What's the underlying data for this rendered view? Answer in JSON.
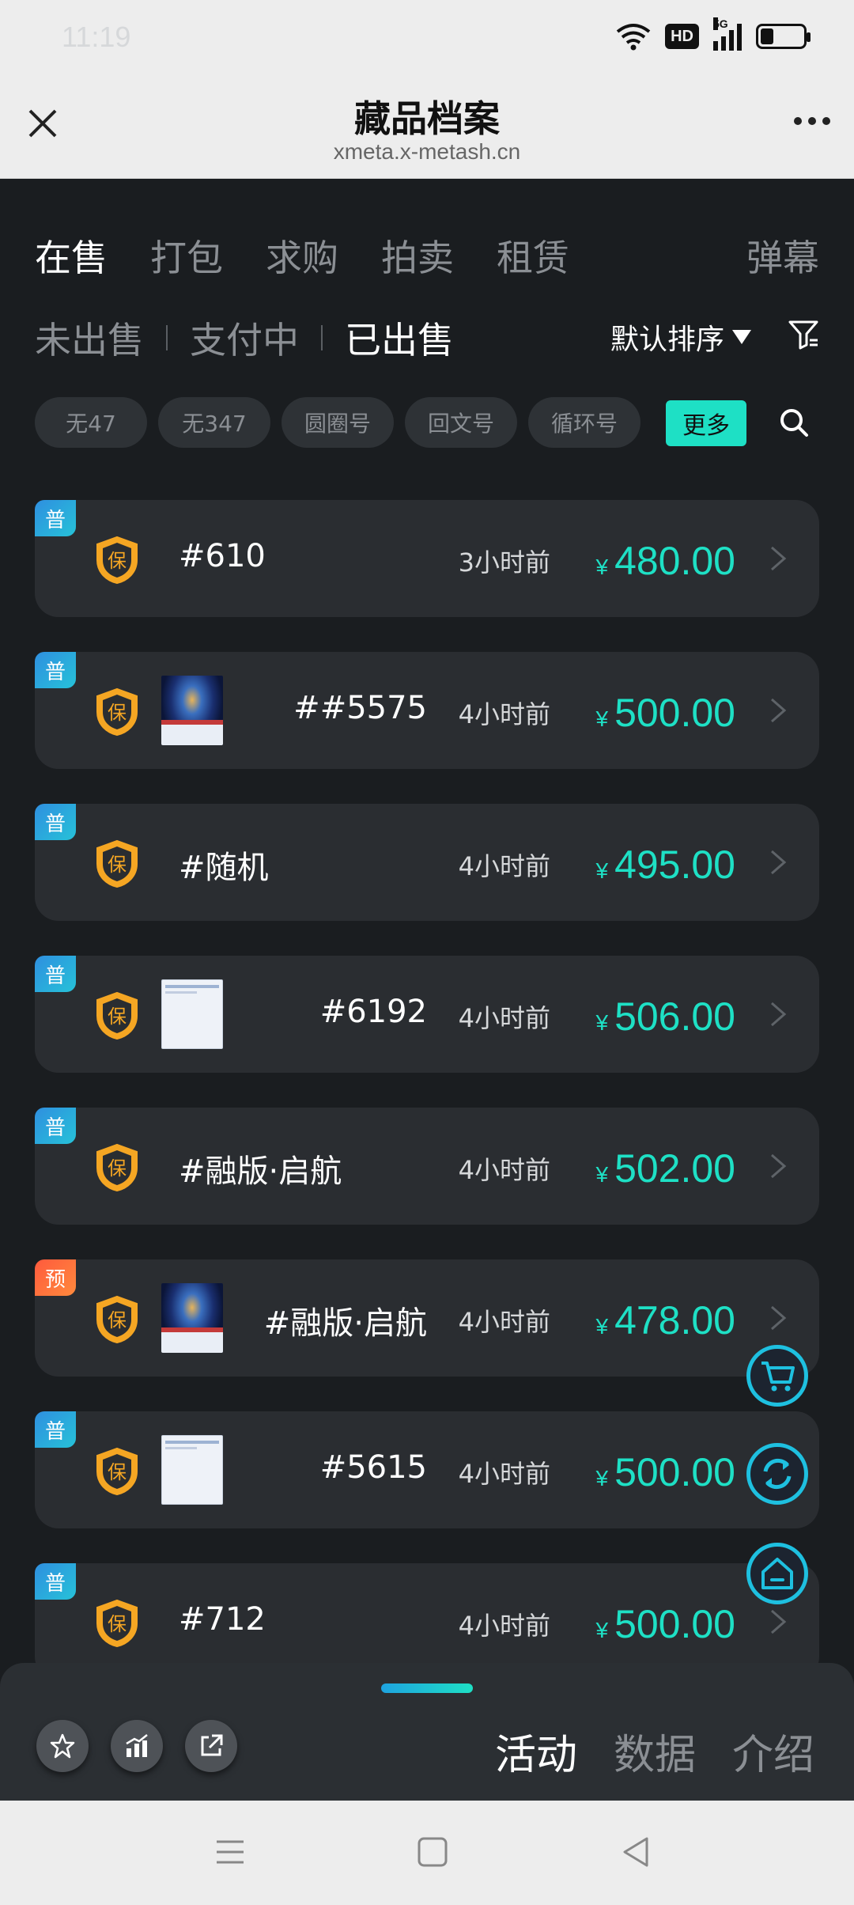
{
  "status_bar": {
    "time": "11:19",
    "hd_label": "HD",
    "network": "5G",
    "battery_level": 0.3
  },
  "header": {
    "title": "藏品档案",
    "url": "xmeta.x-metash.cn"
  },
  "top_tabs": [
    {
      "label": "在售",
      "active": true
    },
    {
      "label": "打包",
      "active": false
    },
    {
      "label": "求购",
      "active": false
    },
    {
      "label": "拍卖",
      "active": false
    },
    {
      "label": "租赁",
      "active": false
    }
  ],
  "danmu_label": "弹幕",
  "sub_tabs": [
    {
      "label": "未出售",
      "active": false
    },
    {
      "label": "支付中",
      "active": false
    },
    {
      "label": "已出售",
      "active": true
    }
  ],
  "sort_label": "默认排序",
  "chips": [
    "无47",
    "无347",
    "圆圈号",
    "回文号",
    "循环号"
  ],
  "more_label": "更多",
  "currency": "¥",
  "items": [
    {
      "badge": "普",
      "name": "#610",
      "time": "3小时前",
      "price": "480.00",
      "thumb": "none"
    },
    {
      "badge": "普",
      "name": "##5575",
      "time": "4小时前",
      "price": "500.00",
      "thumb": "galaxy"
    },
    {
      "badge": "普",
      "name": "#随机",
      "time": "4小时前",
      "price": "495.00",
      "thumb": "none"
    },
    {
      "badge": "普",
      "name": "#6192",
      "time": "4小时前",
      "price": "506.00",
      "thumb": "doc"
    },
    {
      "badge": "普",
      "name": "#融版·启航",
      "time": "4小时前",
      "price": "502.00",
      "thumb": "none"
    },
    {
      "badge": "预",
      "name": "#融版·启航",
      "time": "4小时前",
      "price": "478.00",
      "thumb": "galaxy"
    },
    {
      "badge": "普",
      "name": "#5615",
      "time": "4小时前",
      "price": "500.00",
      "thumb": "doc"
    },
    {
      "badge": "普",
      "name": "#712",
      "time": "4小时前",
      "price": "500.00",
      "thumb": "none"
    }
  ],
  "shield_char": "保",
  "bottom_tabs": [
    {
      "label": "活动",
      "active": true
    },
    {
      "label": "数据",
      "active": false
    },
    {
      "label": "介绍",
      "active": false
    }
  ]
}
